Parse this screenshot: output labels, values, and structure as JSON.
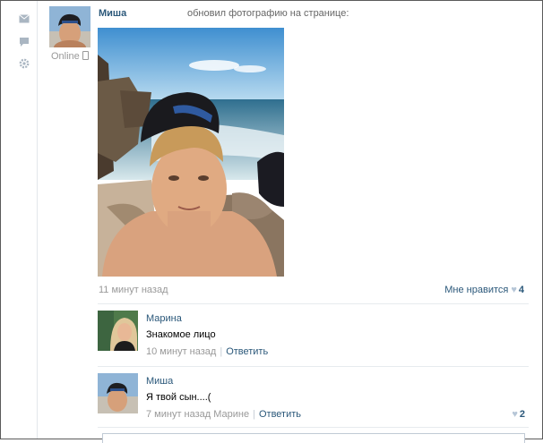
{
  "rail": {
    "icons": [
      "envelope-icon",
      "comment-bubble-icon",
      "gear-icon"
    ]
  },
  "profile": {
    "status": "Online"
  },
  "post": {
    "author": "Миша",
    "action": "обновил фотографию на странице:",
    "time": "11 минут назад",
    "like_label": "Мне нравится",
    "like_count": "4"
  },
  "comments": [
    {
      "author": "Марина",
      "text": "Знакомое лицо",
      "time": "10 минут назад",
      "reply": "Ответить"
    },
    {
      "author": "Миша",
      "text": "Я твой сын....(",
      "time": "7 минут назад Марине",
      "reply": "Ответить",
      "like_count": "2"
    }
  ],
  "colors": {
    "link": "#2b587a",
    "muted": "#999999",
    "divider": "#e7ebee"
  }
}
